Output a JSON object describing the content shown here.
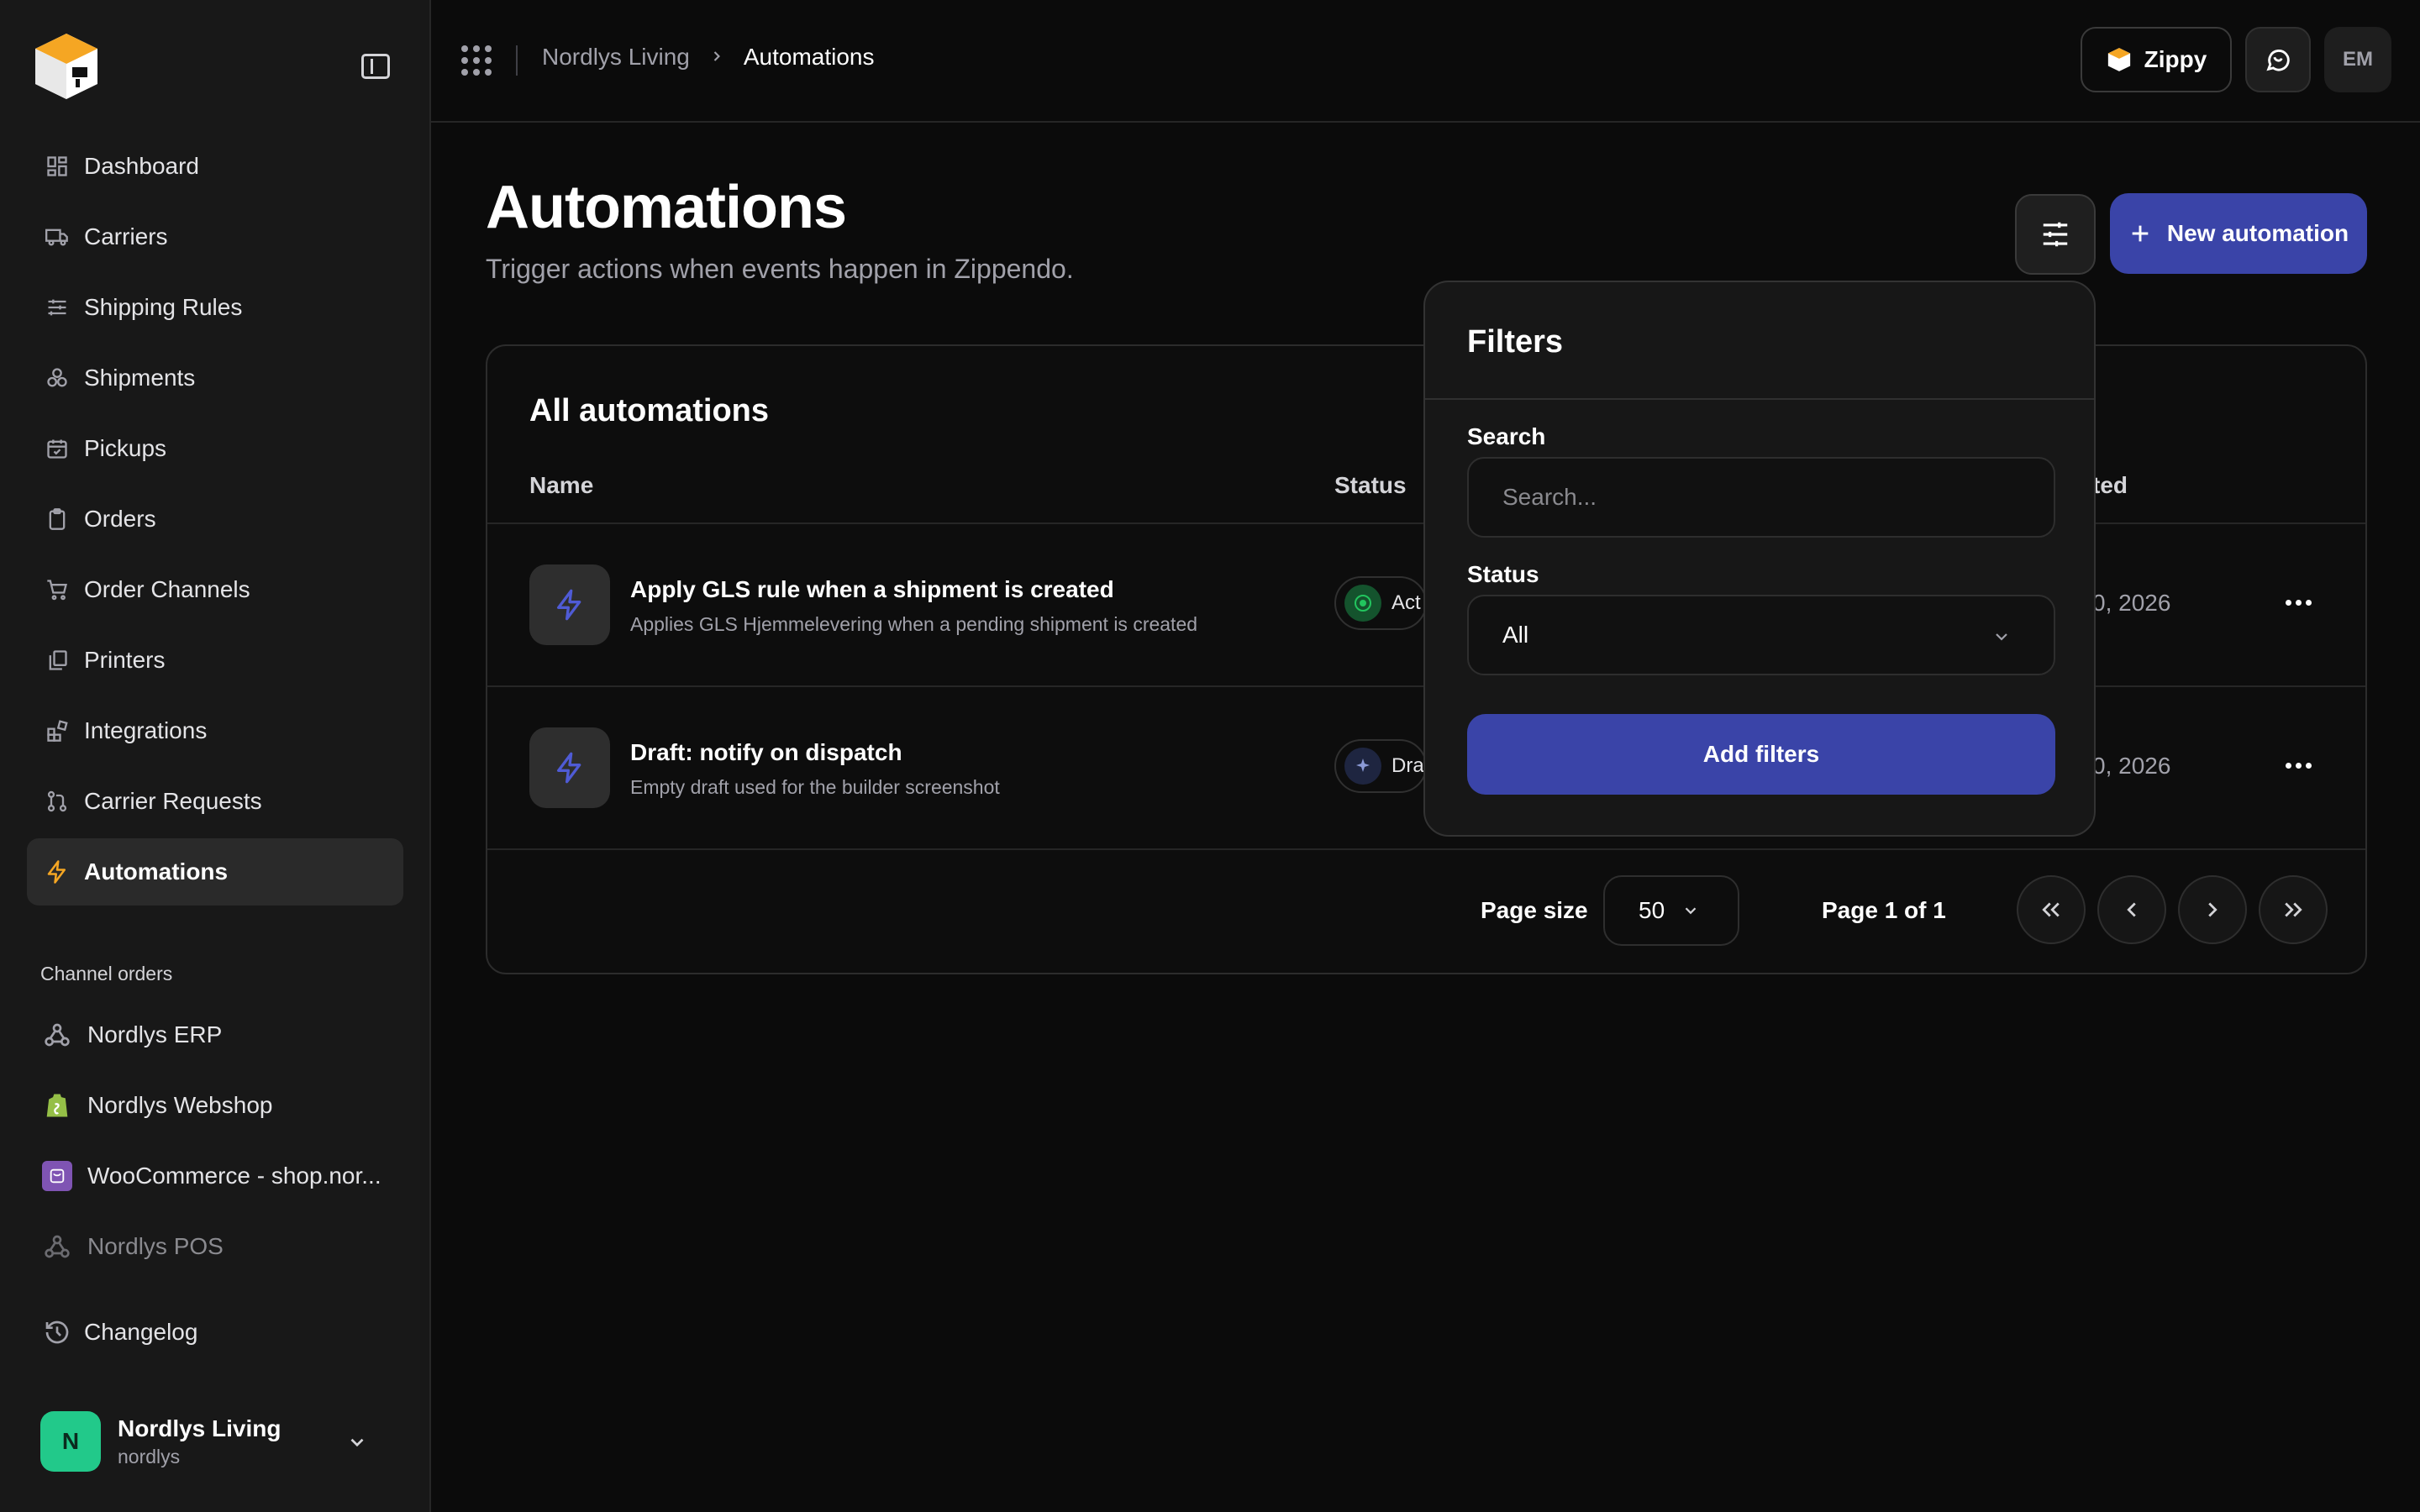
{
  "app": {
    "name": "Zippendo"
  },
  "sidebar": {
    "items": [
      {
        "label": "Dashboard",
        "icon": "dashboard-icon"
      },
      {
        "label": "Carriers",
        "icon": "truck-icon"
      },
      {
        "label": "Shipping Rules",
        "icon": "sliders-icon"
      },
      {
        "label": "Shipments",
        "icon": "boxes-icon"
      },
      {
        "label": "Pickups",
        "icon": "calendar-check-icon"
      },
      {
        "label": "Orders",
        "icon": "clipboard-icon"
      },
      {
        "label": "Order Channels",
        "icon": "cart-icon"
      },
      {
        "label": "Printers",
        "icon": "printer-icon"
      },
      {
        "label": "Integrations",
        "icon": "blocks-icon"
      },
      {
        "label": "Carrier Requests",
        "icon": "git-pull-icon"
      },
      {
        "label": "Automations",
        "icon": "bolt-icon",
        "active": true
      }
    ],
    "channel_section_label": "Channel orders",
    "channels": [
      {
        "label": "Nordlys ERP",
        "icon": "webhook-icon"
      },
      {
        "label": "Nordlys Webshop",
        "icon": "shopify-icon"
      },
      {
        "label": "WooCommerce - shop.nor...",
        "icon": "woocommerce-icon"
      },
      {
        "label": "Nordlys POS",
        "icon": "webhook-icon",
        "muted": true
      }
    ],
    "changelog_label": "Changelog",
    "account": {
      "initial": "N",
      "name": "Nordlys Living",
      "handle": "nordlys"
    }
  },
  "topbar": {
    "breadcrumb": [
      "Nordlys Living",
      "Automations"
    ],
    "zippy_label": "Zippy",
    "user_initials": "EM"
  },
  "page": {
    "title": "Automations",
    "subtitle": "Trigger actions when events happen in Zippendo.",
    "new_button_label": "New automation"
  },
  "table": {
    "title": "All automations",
    "columns": {
      "name": "Name",
      "status": "Status",
      "updated": "ted"
    },
    "rows": [
      {
        "name": "Apply GLS rule when a shipment is created",
        "description": "Applies GLS Hjemmelevering when a pending shipment is created",
        "status": "Act",
        "status_color": "#22c55e",
        "date": "0, 2026"
      },
      {
        "name": "Draft: notify on dispatch",
        "description": "Empty draft used for the builder screenshot",
        "status": "Dra",
        "status_color": "#6b7bbf",
        "date": "0, 2026"
      }
    ],
    "pagination": {
      "page_size_label": "Page size",
      "page_size": "50",
      "page_label": "Page 1 of 1"
    }
  },
  "filters": {
    "title": "Filters",
    "search_label": "Search",
    "search_placeholder": "Search...",
    "status_label": "Status",
    "status_value": "All",
    "apply_label": "Add filters"
  },
  "colors": {
    "accent": "#3a44a8",
    "logo_orange": "#f5a623",
    "active_icon": "#f5a623"
  }
}
